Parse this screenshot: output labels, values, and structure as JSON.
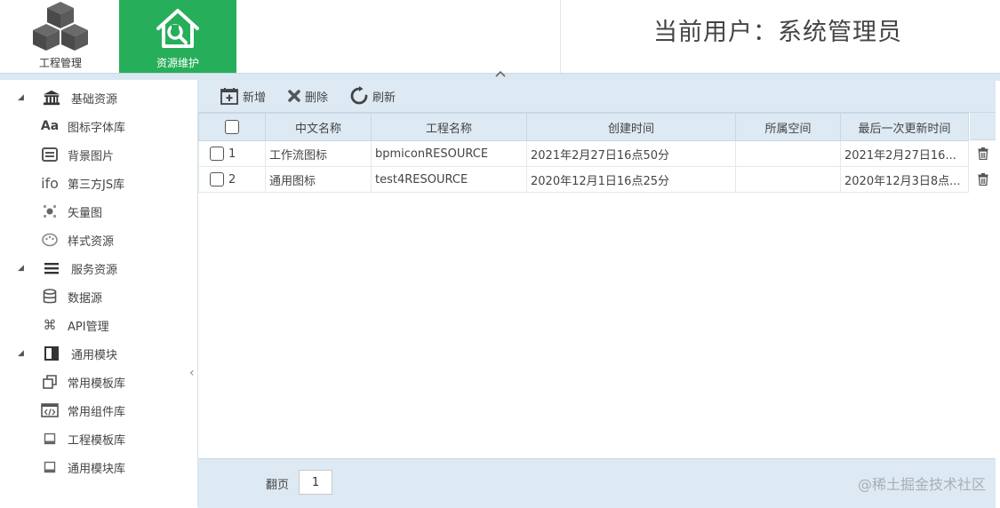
{
  "nav": {
    "project_tab": {
      "label": "工程管理",
      "icon": "cubes-icon"
    },
    "resource_tab": {
      "label": "资源维护",
      "icon": "house-wrench-icon",
      "active_color": "#27ae5a"
    }
  },
  "header": {
    "current_user": "当前用户：系统管理员"
  },
  "sidebar": {
    "groups": [
      {
        "label": "基础资源",
        "icon": "bank-icon",
        "items": [
          {
            "label": "图标字体库",
            "icon": "font-icon"
          },
          {
            "label": "背景图片",
            "icon": "image-icon"
          },
          {
            "label": "第三方JS库",
            "icon": "ifo-icon"
          },
          {
            "label": "矢量图",
            "icon": "vector-icon"
          },
          {
            "label": "样式资源",
            "icon": "palette-icon"
          }
        ]
      },
      {
        "label": "服务资源",
        "icon": "list-icon",
        "items": [
          {
            "label": "数据源",
            "icon": "database-icon"
          },
          {
            "label": "API管理",
            "icon": "command-icon"
          }
        ]
      },
      {
        "label": "通用模块",
        "icon": "module-icon",
        "items": [
          {
            "label": "常用模板库",
            "icon": "copy-icon"
          },
          {
            "label": "常用组件库",
            "icon": "code-icon"
          },
          {
            "label": "工程模板库",
            "icon": "window-icon"
          },
          {
            "label": "通用模块库",
            "icon": "window-icon"
          }
        ]
      }
    ]
  },
  "toolbar": {
    "add_label": "新增",
    "delete_label": "删除",
    "refresh_label": "刷新"
  },
  "table": {
    "columns": [
      "中文名称",
      "工程名称",
      "创建时间",
      "所属空间",
      "最后一次更新时间"
    ],
    "rows": [
      {
        "num": "1",
        "cn_name": "工作流图标",
        "project_name": "bpmiconRESOURCE",
        "created": "2021年2月27日16点50分",
        "space": "",
        "updated": "2021年2月27日16..."
      },
      {
        "num": "2",
        "cn_name": "通用图标",
        "project_name": "test4RESOURCE",
        "created": "2020年12月1日16点25分",
        "space": "",
        "updated": "2020年12月3日8点..."
      }
    ]
  },
  "pager": {
    "label": "翻页",
    "page": "1"
  },
  "watermark": "@稀土掘金技术社区",
  "colors": {
    "accent_green": "#27ae5a",
    "toolbar_blue": "#dde9f3"
  }
}
